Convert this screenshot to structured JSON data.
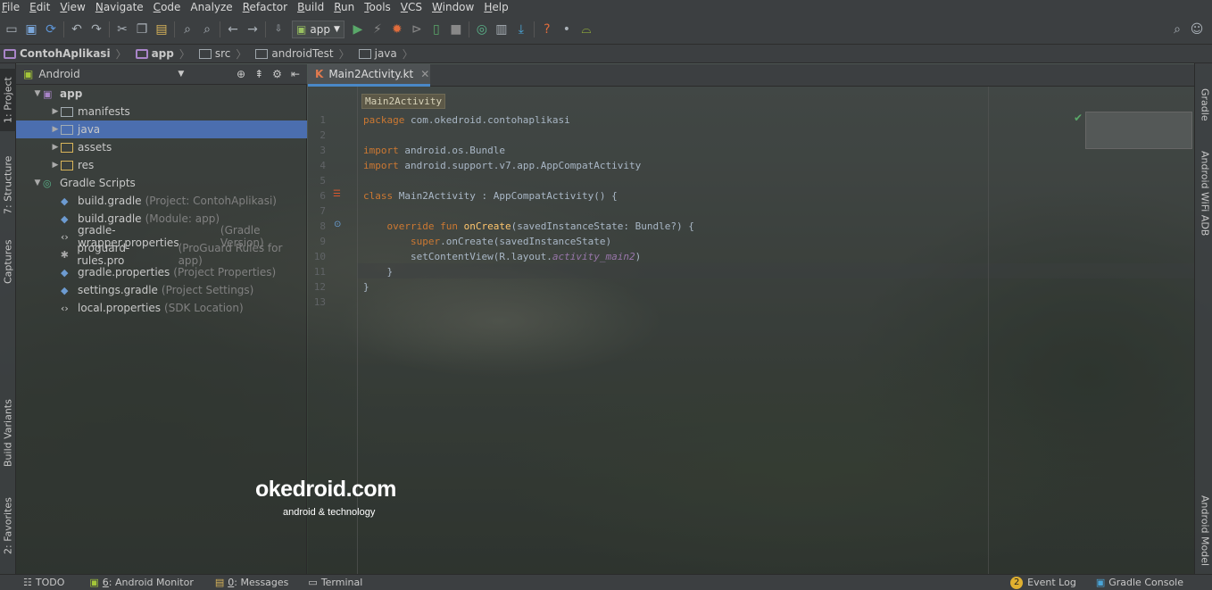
{
  "menu": {
    "items": [
      {
        "u": "F",
        "rest": "ile"
      },
      {
        "u": "E",
        "rest": "dit"
      },
      {
        "u": "V",
        "rest": "iew"
      },
      {
        "u": "N",
        "rest": "avigate"
      },
      {
        "u": "C",
        "rest": "ode"
      },
      {
        "u": "",
        "rest": "Analyze"
      },
      {
        "u": "R",
        "rest": "efactor"
      },
      {
        "u": "B",
        "rest": "uild"
      },
      {
        "u": "R",
        "rest": "un"
      },
      {
        "u": "T",
        "rest": "ools"
      },
      {
        "u": "V",
        "rest": "CS"
      },
      {
        "u": "W",
        "rest": "indow"
      },
      {
        "u": "H",
        "rest": "elp"
      }
    ]
  },
  "toolbar": {
    "run_config": "app",
    "icons": [
      "open-icon",
      "save-icon",
      "sync-icon",
      "undo-icon",
      "redo-icon",
      "cut-icon",
      "copy-icon",
      "paste-icon",
      "find-icon",
      "replace-icon",
      "back-icon",
      "forward-icon",
      "make-icon",
      "run-icon",
      "apply-changes-icon",
      "debug-icon",
      "attach-icon",
      "coverage-icon",
      "stop-icon",
      "gradle-sync-icon",
      "avd-manager-icon",
      "sdk-manager-icon",
      "help-icon",
      "device-icon",
      "android-icon"
    ]
  },
  "breadcrumb": [
    "ContohAplikasi",
    "app",
    "src",
    "androidTest",
    "java"
  ],
  "sidebar_left": {
    "project": "1: Project",
    "structure": "7: Structure",
    "captures": "Captures",
    "build_variants": "Build Variants",
    "favorites": "2: Favorites"
  },
  "sidebar_right": {
    "gradle": "Gradle",
    "wifi_adb": "Android WiFi ADB",
    "model": "Android Model"
  },
  "project_panel": {
    "view": "Android",
    "tree": [
      {
        "label": "app",
        "hint": "",
        "indent": 0,
        "arrow": "▼",
        "icon": "module-icon",
        "selected": false
      },
      {
        "label": "manifests",
        "hint": "",
        "indent": 1,
        "arrow": "▶",
        "icon": "folder-icon",
        "selected": false
      },
      {
        "label": "java",
        "hint": "",
        "indent": 1,
        "arrow": "▶",
        "icon": "folder-icon",
        "selected": true
      },
      {
        "label": "assets",
        "hint": "",
        "indent": 1,
        "arrow": "▶",
        "icon": "folder-icon",
        "selected": false
      },
      {
        "label": "res",
        "hint": "",
        "indent": 1,
        "arrow": "▶",
        "icon": "folder-icon",
        "selected": false
      },
      {
        "label": "Gradle Scripts",
        "hint": "",
        "indent": 0,
        "arrow": "▼",
        "icon": "gradle-icon",
        "selected": false
      },
      {
        "label": "build.gradle",
        "hint": "(Project: ContohAplikasi)",
        "indent": 1,
        "arrow": "",
        "icon": "gradle-file-icon",
        "selected": false
      },
      {
        "label": "build.gradle",
        "hint": "(Module: app)",
        "indent": 1,
        "arrow": "",
        "icon": "gradle-file-icon",
        "selected": false
      },
      {
        "label": "gradle-wrapper.properties",
        "hint": "(Gradle Version)",
        "indent": 1,
        "arrow": "",
        "icon": "properties-icon",
        "selected": false
      },
      {
        "label": "proguard-rules.pro",
        "hint": "(ProGuard Rules for app)",
        "indent": 1,
        "arrow": "",
        "icon": "asterisk-icon",
        "selected": false
      },
      {
        "label": "gradle.properties",
        "hint": "(Project Properties)",
        "indent": 1,
        "arrow": "",
        "icon": "gradle-file-icon",
        "selected": false
      },
      {
        "label": "settings.gradle",
        "hint": "(Project Settings)",
        "indent": 1,
        "arrow": "",
        "icon": "gradle-file-icon",
        "selected": false
      },
      {
        "label": "local.properties",
        "hint": "(SDK Location)",
        "indent": 1,
        "arrow": "",
        "icon": "properties-icon",
        "selected": false
      }
    ]
  },
  "editor": {
    "tab": "Main2Activity.kt",
    "tooltip": "Main2Activity",
    "lines": [
      "1",
      "2",
      "3",
      "4",
      "5",
      "6",
      "7",
      "8",
      "9",
      "10",
      "11",
      "12",
      "13"
    ]
  },
  "watermark": {
    "brand": "okedroid.com",
    "tagline": "android & technology"
  },
  "status": {
    "todo": "TODO",
    "monitor_u": "6",
    "monitor": ": Android Monitor",
    "messages_u": "0",
    "messages": ": Messages",
    "terminal": "Terminal",
    "event_count": "2",
    "event_log": "Event Log",
    "gradle_console": "Gradle Console"
  }
}
